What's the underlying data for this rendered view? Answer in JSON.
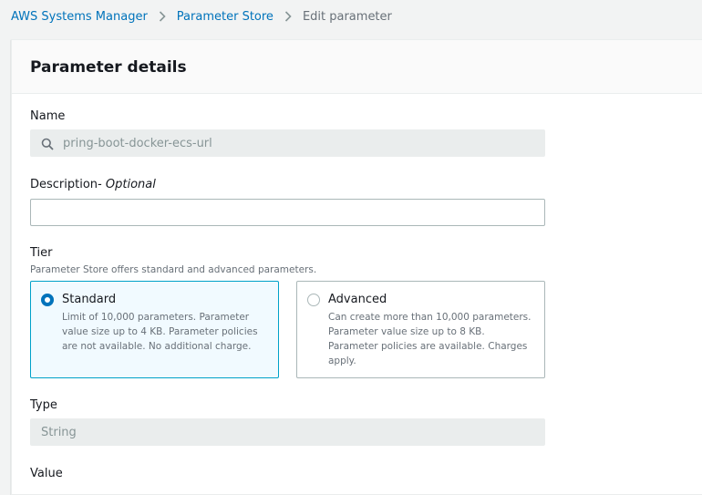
{
  "breadcrumb": {
    "items": [
      "AWS Systems Manager",
      "Parameter Store"
    ],
    "current": "Edit parameter"
  },
  "panel": {
    "title": "Parameter details"
  },
  "name_field": {
    "label": "Name",
    "value": "pring-boot-docker-ecs-url"
  },
  "description_field": {
    "label": "Description",
    "optional": "- Optional",
    "value": ""
  },
  "tier": {
    "label": "Tier",
    "hint": "Parameter Store offers standard and advanced parameters.",
    "options": [
      {
        "title": "Standard",
        "description": "Limit of 10,000 parameters. Parameter value size up to 4 KB. Parameter policies are not available. No additional charge.",
        "selected": true
      },
      {
        "title": "Advanced",
        "description": "Can create more than 10,000 parameters. Parameter value size up to 8 KB. Parameter policies are available. Charges apply.",
        "selected": false
      }
    ]
  },
  "type_field": {
    "label": "Type",
    "value": "String"
  },
  "value_field": {
    "label": "Value"
  },
  "colors": {
    "link": "#0073bb",
    "selected_border": "#00a1c9",
    "selected_bg": "#f1faff",
    "disabled_bg": "#eaeded"
  }
}
